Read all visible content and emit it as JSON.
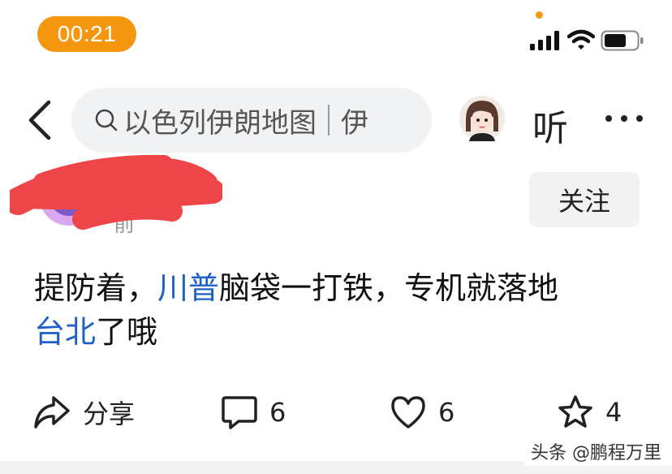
{
  "status_bar": {
    "time": "00:21",
    "accent_color": "#f5960f"
  },
  "nav": {
    "search_query": "以色列伊朗地图",
    "search_next": "伊",
    "listen_label": "听"
  },
  "post": {
    "author_name": "",
    "time_text": "前",
    "follow_label": "关注",
    "content": {
      "part1": "提防着，",
      "topic1": "川普",
      "part2": "脑袋一打铁，专机就落地",
      "topic2": "台北",
      "part3": "了哦"
    },
    "topic_color": "#1e60c8"
  },
  "actions": {
    "share_label": "分享",
    "comment_count": "6",
    "like_count": "6",
    "fav_count": "4"
  },
  "watermark": "头条 @鹏程万里"
}
